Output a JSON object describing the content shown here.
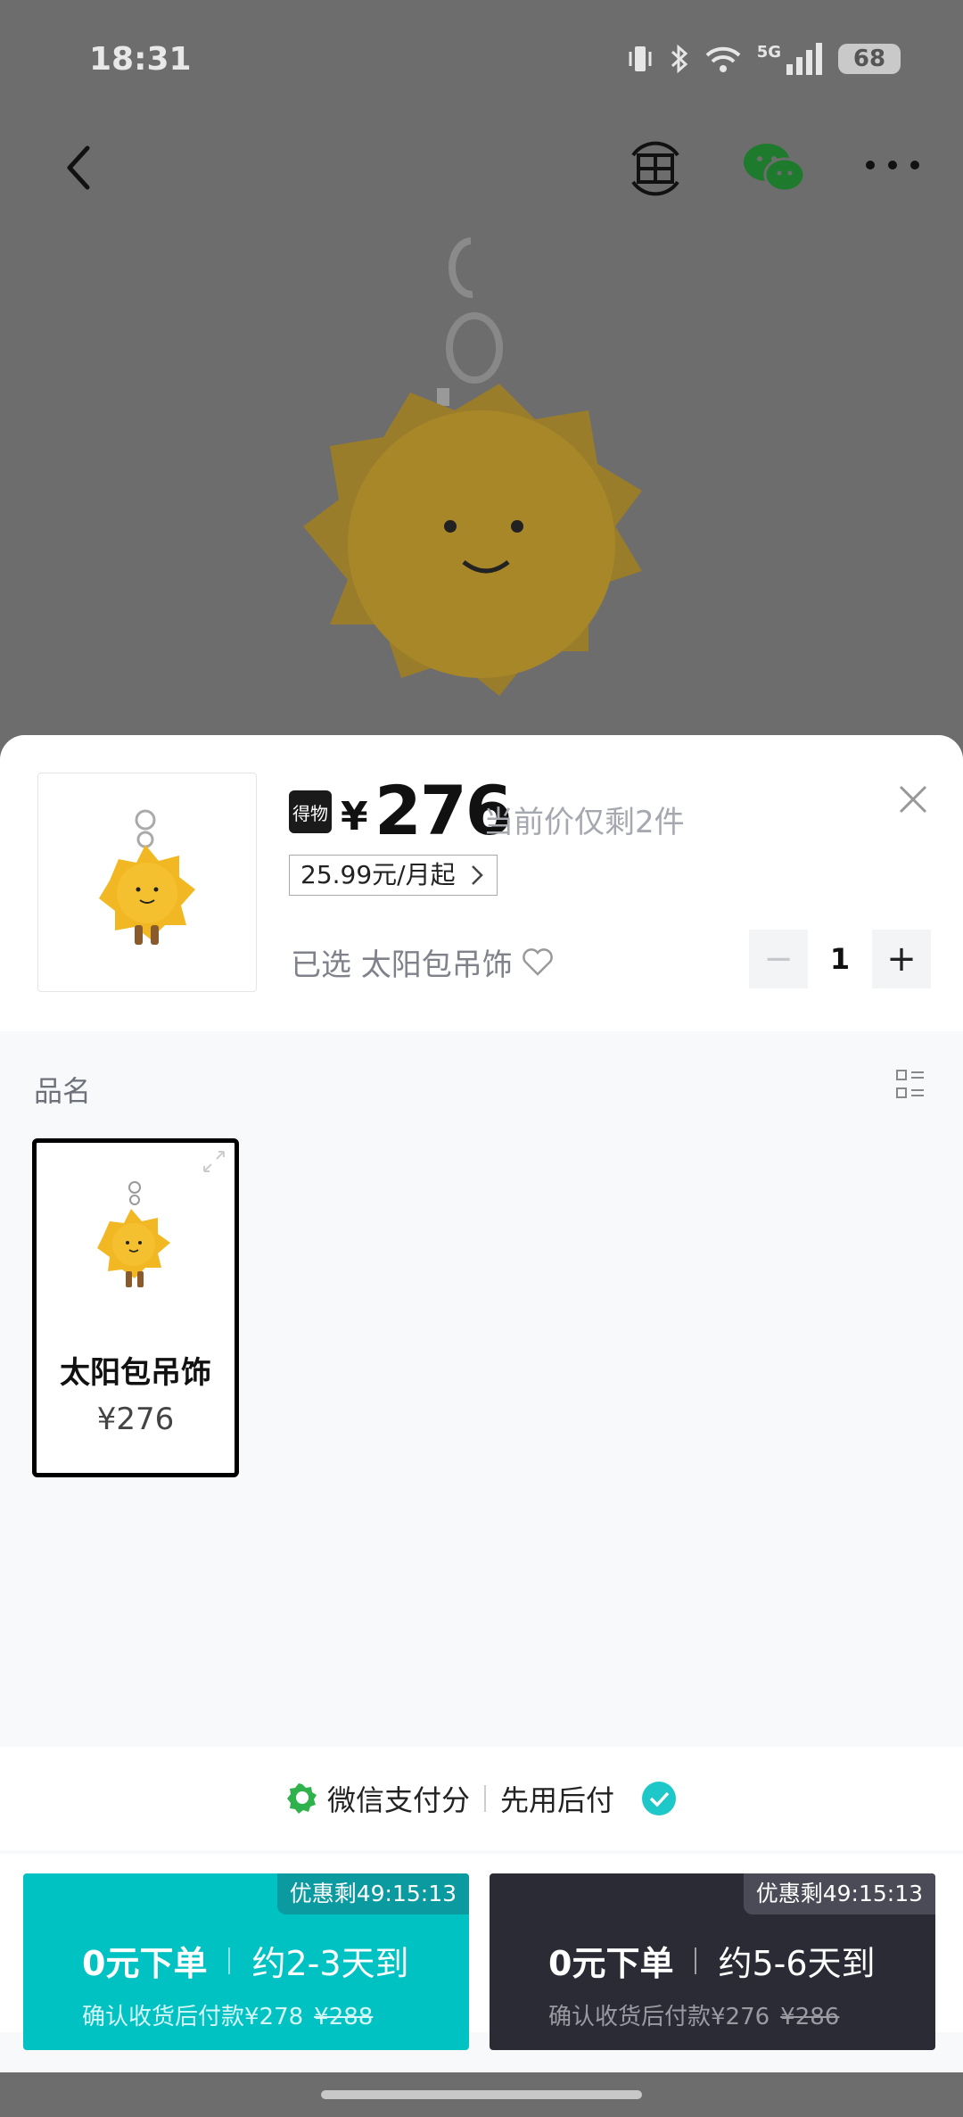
{
  "status_bar": {
    "time": "18:31",
    "network": "5G",
    "battery": "68"
  },
  "product": {
    "brand_badge": "得物",
    "currency": "¥",
    "price": "276",
    "stock_note": "当前价仅剩2件",
    "installment": "25.99元/月起",
    "selected_text": "已选 太阳包吊饰"
  },
  "stepper": {
    "quantity": "1",
    "minus": "−",
    "plus": "+"
  },
  "section": {
    "label": "品名"
  },
  "sku": {
    "name": "太阳包吊饰",
    "price": "¥276"
  },
  "payment": {
    "wechat_score": "微信支付分",
    "pay_later": "先用后付"
  },
  "buttons": [
    {
      "promo": "优惠剩49:15:13",
      "main": "0元下单",
      "delivery": "约2-3天到",
      "sub": "确认收货后付款¥278",
      "original": "¥288"
    },
    {
      "promo": "优惠剩49:15:13",
      "main": "0元下单",
      "delivery": "约5-6天到",
      "sub": "确认收货后付款¥276",
      "original": "¥286"
    }
  ],
  "colors": {
    "teal": "#01c2c3",
    "dark": "#2b2b36",
    "check": "#1ec8c8"
  }
}
